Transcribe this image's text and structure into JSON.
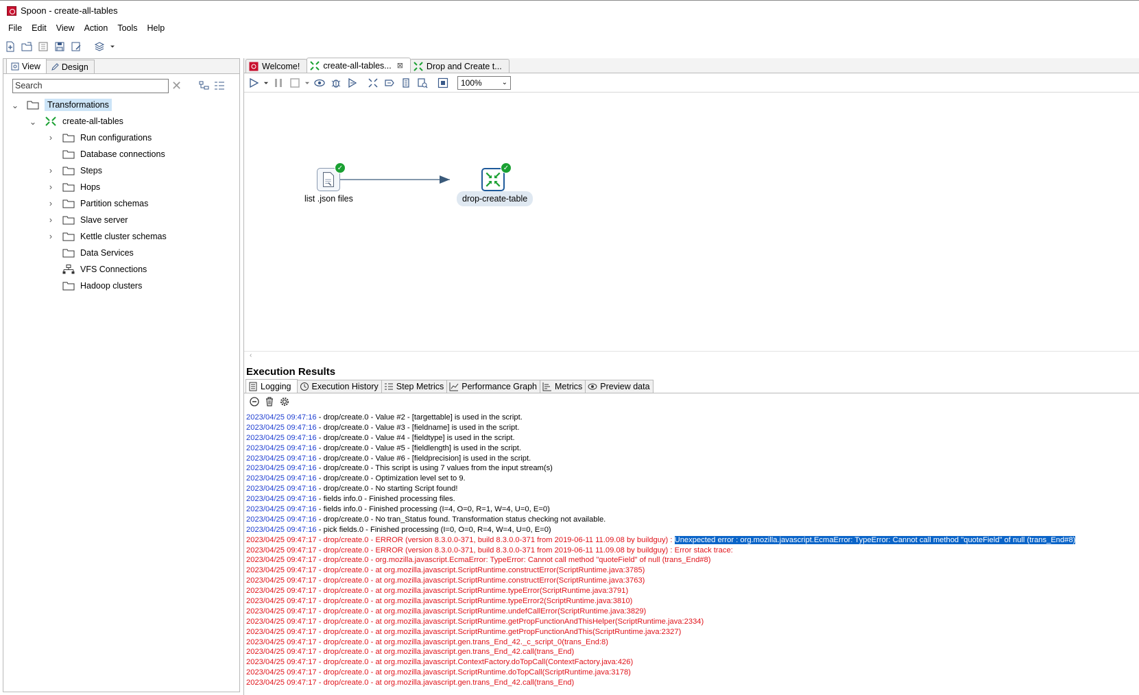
{
  "window": {
    "title": "Spoon - create-all-tables"
  },
  "menu": [
    "File",
    "Edit",
    "View",
    "Action",
    "Tools",
    "Help"
  ],
  "left_panel": {
    "tabs": [
      {
        "label": "View"
      },
      {
        "label": "Design"
      }
    ],
    "search": {
      "placeholder": "Search"
    },
    "tree": {
      "root": "Transformations",
      "transformation": "create-all-tables",
      "children": [
        "Run configurations",
        "Database connections",
        "Steps",
        "Hops",
        "Partition schemas",
        "Slave server",
        "Kettle cluster schemas",
        "Data Services",
        "VFS Connections",
        "Hadoop clusters"
      ]
    }
  },
  "editor": {
    "tabs": [
      {
        "label": "Welcome!"
      },
      {
        "label": "create-all-tables..."
      },
      {
        "label": "Drop and Create t..."
      }
    ],
    "zoom": "100%",
    "steps": [
      {
        "label": "list .json files"
      },
      {
        "label": "drop-create-table"
      }
    ]
  },
  "execution": {
    "title": "Execution Results",
    "tabs": [
      "Logging",
      "Execution History",
      "Step Metrics",
      "Performance Graph",
      "Metrics",
      "Preview data"
    ],
    "log": [
      {
        "ts": "2023/04/25 09:47:16",
        "level": "info",
        "msg": " - drop/create.0 - Value #2 -  [targettable] is used in the script."
      },
      {
        "ts": "2023/04/25 09:47:16",
        "level": "info",
        "msg": " - drop/create.0 - Value #3 -  [fieldname] is used in the script."
      },
      {
        "ts": "2023/04/25 09:47:16",
        "level": "info",
        "msg": " - drop/create.0 - Value #4 -  [fieldtype] is used in the script."
      },
      {
        "ts": "2023/04/25 09:47:16",
        "level": "info",
        "msg": " - drop/create.0 - Value #5 -  [fieldlength] is used in the script."
      },
      {
        "ts": "2023/04/25 09:47:16",
        "level": "info",
        "msg": " - drop/create.0 - Value #6 -  [fieldprecision] is used in the script."
      },
      {
        "ts": "2023/04/25 09:47:16",
        "level": "info",
        "msg": " - drop/create.0 - This script is using 7 values from the input stream(s)"
      },
      {
        "ts": "2023/04/25 09:47:16",
        "level": "info",
        "msg": " - drop/create.0 - Optimization level set to 9."
      },
      {
        "ts": "2023/04/25 09:47:16",
        "level": "info",
        "msg": " - drop/create.0 - No starting Script found!"
      },
      {
        "ts": "2023/04/25 09:47:16",
        "level": "info",
        "msg": " - fields info.0 - Finished processing files."
      },
      {
        "ts": "2023/04/25 09:47:16",
        "level": "info",
        "msg": " - fields info.0 - Finished processing (I=4, O=0, R=1, W=4, U=0, E=0)"
      },
      {
        "ts": "2023/04/25 09:47:16",
        "level": "info",
        "msg": " - drop/create.0 - No tran_Status found. Transformation status checking not available."
      },
      {
        "ts": "2023/04/25 09:47:16",
        "level": "info",
        "msg": " - pick fields.0 - Finished processing (I=0, O=0, R=4, W=4, U=0, E=0)"
      },
      {
        "ts": "2023/04/25 09:47:17",
        "level": "error",
        "msg": " - drop/create.0 - ERROR (version 8.3.0.0-371, build 8.3.0.0-371 from 2019-06-11 11.09.08 by buildguy) : ",
        "highlight": "Unexpected error : org.mozilla.javascript.EcmaError: TypeError: Cannot call method \"quoteField\" of null (trans_End#8)"
      },
      {
        "ts": "2023/04/25 09:47:17",
        "level": "error",
        "msg": " - drop/create.0 - ERROR (version 8.3.0.0-371, build 8.3.0.0-371 from 2019-06-11 11.09.08 by buildguy) : Error stack trace:"
      },
      {
        "ts": "2023/04/25 09:47:17",
        "level": "error",
        "msg": " - drop/create.0 - org.mozilla.javascript.EcmaError: TypeError: Cannot call method \"quoteField\" of null (trans_End#8)"
      },
      {
        "ts": "2023/04/25 09:47:17",
        "level": "error",
        "msg": " - drop/create.0 -    at org.mozilla.javascript.ScriptRuntime.constructError(ScriptRuntime.java:3785)"
      },
      {
        "ts": "2023/04/25 09:47:17",
        "level": "error",
        "msg": " - drop/create.0 -    at org.mozilla.javascript.ScriptRuntime.constructError(ScriptRuntime.java:3763)"
      },
      {
        "ts": "2023/04/25 09:47:17",
        "level": "error",
        "msg": " - drop/create.0 -    at org.mozilla.javascript.ScriptRuntime.typeError(ScriptRuntime.java:3791)"
      },
      {
        "ts": "2023/04/25 09:47:17",
        "level": "error",
        "msg": " - drop/create.0 -    at org.mozilla.javascript.ScriptRuntime.typeError2(ScriptRuntime.java:3810)"
      },
      {
        "ts": "2023/04/25 09:47:17",
        "level": "error",
        "msg": " - drop/create.0 -    at org.mozilla.javascript.ScriptRuntime.undefCallError(ScriptRuntime.java:3829)"
      },
      {
        "ts": "2023/04/25 09:47:17",
        "level": "error",
        "msg": " - drop/create.0 -    at org.mozilla.javascript.ScriptRuntime.getPropFunctionAndThisHelper(ScriptRuntime.java:2334)"
      },
      {
        "ts": "2023/04/25 09:47:17",
        "level": "error",
        "msg": " - drop/create.0 -    at org.mozilla.javascript.ScriptRuntime.getPropFunctionAndThis(ScriptRuntime.java:2327)"
      },
      {
        "ts": "2023/04/25 09:47:17",
        "level": "error",
        "msg": " - drop/create.0 -    at org.mozilla.javascript.gen.trans_End_42._c_script_0(trans_End:8)"
      },
      {
        "ts": "2023/04/25 09:47:17",
        "level": "error",
        "msg": " - drop/create.0 -    at org.mozilla.javascript.gen.trans_End_42.call(trans_End)"
      },
      {
        "ts": "2023/04/25 09:47:17",
        "level": "error",
        "msg": " - drop/create.0 -    at org.mozilla.javascript.ContextFactory.doTopCall(ContextFactory.java:426)"
      },
      {
        "ts": "2023/04/25 09:47:17",
        "level": "error",
        "msg": " - drop/create.0 -    at org.mozilla.javascript.ScriptRuntime.doTopCall(ScriptRuntime.java:3178)"
      },
      {
        "ts": "2023/04/25 09:47:17",
        "level": "error",
        "msg": " - drop/create.0 -    at org.mozilla.javascript.gen.trans_End_42.call(trans_End)"
      }
    ]
  },
  "colors": {
    "log_timestamp": "#1f3fd1",
    "log_error": "#e0131a",
    "selection": "#0a64c8",
    "tree_selected": "#cce4f7",
    "step_ok": "#1aa032"
  }
}
